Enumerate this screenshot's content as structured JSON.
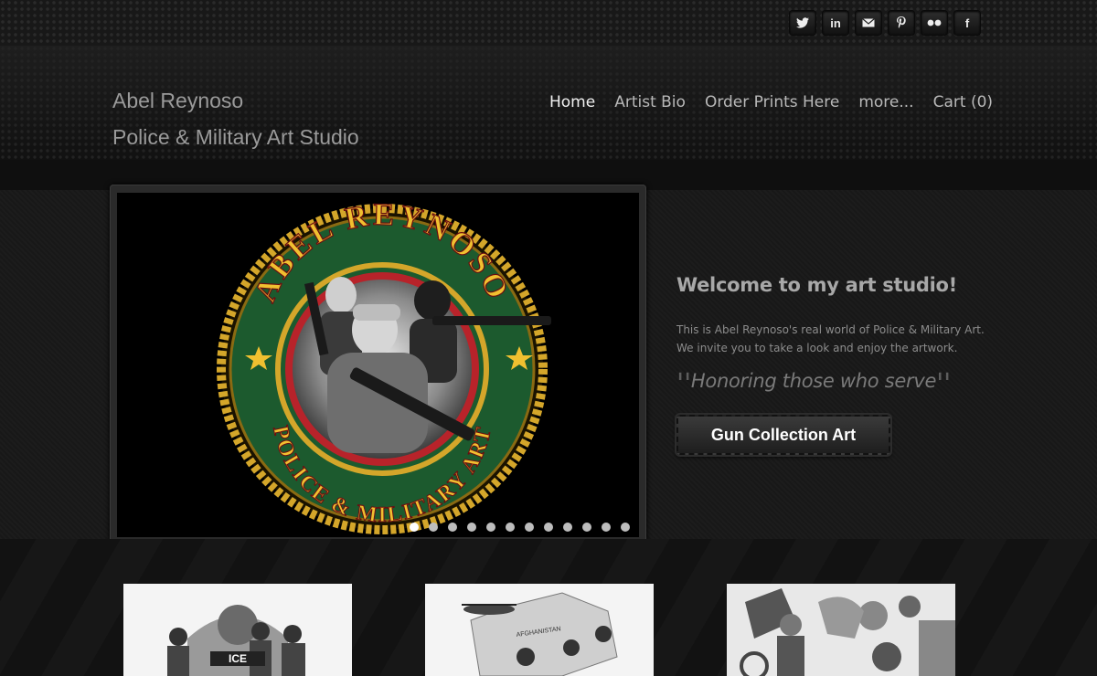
{
  "social": {
    "items": [
      {
        "name": "twitter",
        "glyph": "🐦"
      },
      {
        "name": "linkedin",
        "glyph": "in"
      },
      {
        "name": "email",
        "glyph": "✉"
      },
      {
        "name": "pinterest",
        "glyph": "P"
      },
      {
        "name": "flickr",
        "glyph": "●●"
      },
      {
        "name": "facebook",
        "glyph": "f"
      }
    ]
  },
  "brand": {
    "line1": "Abel Reynoso",
    "line2": "Police & Military Art Studio"
  },
  "nav": {
    "home": "Home",
    "bio": "Artist Bio",
    "prints": "Order Prints Here",
    "more": "more...",
    "cart": "Cart (0)",
    "active": "Home"
  },
  "hero": {
    "title": "Welcome to my art studio!",
    "text1": "This is Abel Reynoso's real world of Police & Military Art.",
    "text2": "We invite you to take a look and enjoy the artwork.",
    "quote": "Honoring those who serve",
    "cta": "Gun Collection Art",
    "slide_count": 12,
    "active_slide": 1
  },
  "slide": {
    "emblem_top": "ABEL REYNOSO",
    "emblem_bottom": "POLICE & MILITARY ART"
  },
  "thumbs": {
    "thumb1_label": "ICE",
    "thumb2_label": "AFGHANISTAN"
  },
  "colors": {
    "accent": "#3d86c0",
    "emblem_gold": "#d4a62a",
    "emblem_green": "#1c5a2e",
    "emblem_red": "#b8232a"
  }
}
